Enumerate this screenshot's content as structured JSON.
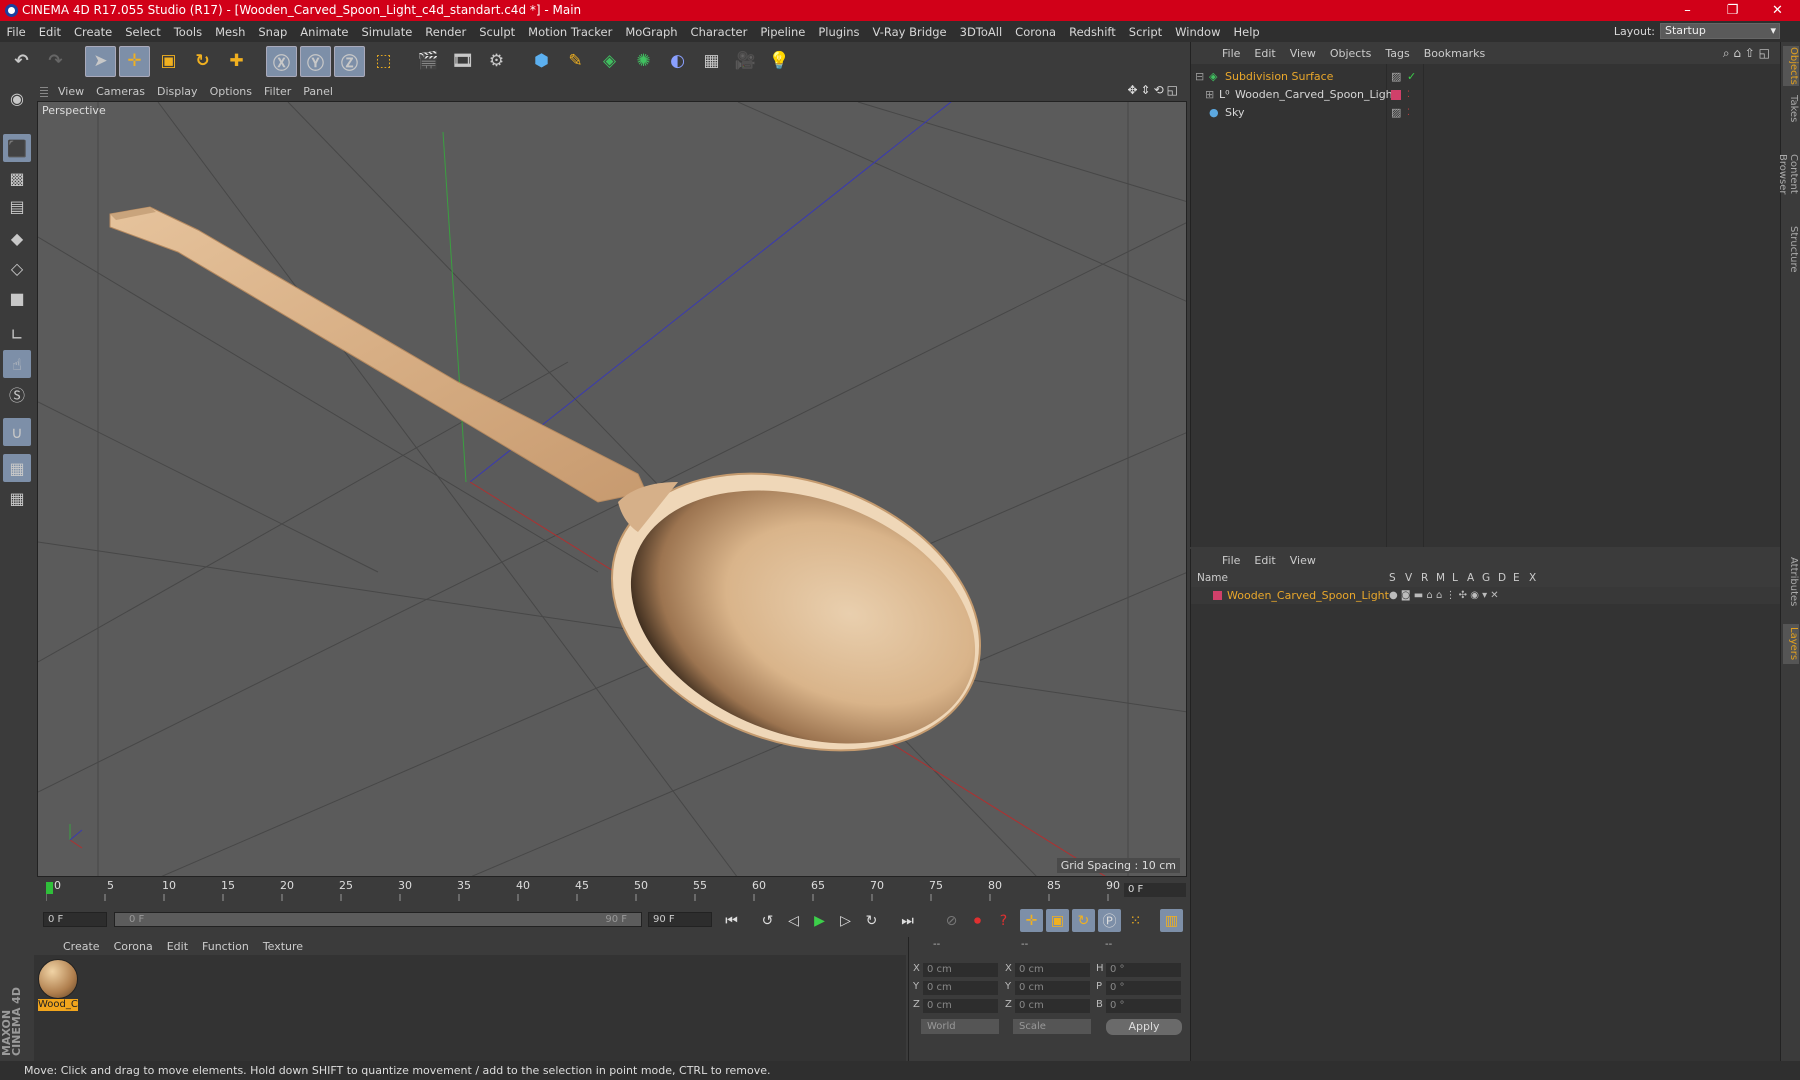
{
  "window": {
    "title": "CINEMA 4D R17.055 Studio (R17) - [Wooden_Carved_Spoon_Light_c4d_standart.c4d *] - Main",
    "controls": [
      "–",
      "❐",
      "✕"
    ]
  },
  "menubar": [
    "File",
    "Edit",
    "Create",
    "Select",
    "Tools",
    "Mesh",
    "Snap",
    "Animate",
    "Simulate",
    "Render",
    "Sculpt",
    "Motion Tracker",
    "MoGraph",
    "Character",
    "Pipeline",
    "Plugins",
    "V-Ray Bridge",
    "3DToAll",
    "Corona",
    "Redshift",
    "Script",
    "Window",
    "Help"
  ],
  "layout": {
    "label": "Layout:",
    "value": "Startup"
  },
  "viewport": {
    "menu": [
      "View",
      "Cameras",
      "Display",
      "Options",
      "Filter",
      "Panel"
    ],
    "camera_label": "Perspective",
    "grid_spacing": "Grid Spacing : 10 cm"
  },
  "timeline": {
    "ticks": [
      "0",
      "5",
      "10",
      "15",
      "20",
      "25",
      "30",
      "35",
      "40",
      "45",
      "50",
      "55",
      "60",
      "65",
      "70",
      "75",
      "80",
      "85",
      "90"
    ],
    "current_frame": "0 F"
  },
  "transport": {
    "start": "0 F",
    "slider_left": "0 F",
    "slider_right": "90 F",
    "end": "90 F"
  },
  "materials": {
    "menu": [
      "Create",
      "Corona",
      "Edit",
      "Function",
      "Texture"
    ],
    "items": [
      {
        "label": "Wood_C"
      }
    ]
  },
  "coordinates": {
    "headers": [
      "--",
      "--",
      "--"
    ],
    "rows": [
      {
        "a": "X",
        "av": "0 cm",
        "b": "X",
        "bv": "0 cm",
        "c": "H",
        "cv": "0 °"
      },
      {
        "a": "Y",
        "av": "0 cm",
        "b": "Y",
        "bv": "0 cm",
        "c": "P",
        "cv": "0 °"
      },
      {
        "a": "Z",
        "av": "0 cm",
        "b": "Z",
        "bv": "0 cm",
        "c": "B",
        "cv": "0 °"
      }
    ],
    "mode": "World",
    "scale": "Scale",
    "apply": "Apply"
  },
  "objects": {
    "menu": [
      "File",
      "Edit",
      "View",
      "Objects",
      "Tags",
      "Bookmarks"
    ],
    "items": [
      {
        "name": "Subdivision Surface",
        "color": "#e9a72b"
      },
      {
        "name": "Wooden_Carved_Spoon_Light",
        "color": "#d6d6d6"
      },
      {
        "name": "Sky",
        "color": "#d6d6d6"
      }
    ]
  },
  "layers": {
    "menu": [
      "File",
      "Edit",
      "View"
    ],
    "header": {
      "name": "Name",
      "cols": [
        "S",
        "V",
        "R",
        "M",
        "L",
        "A",
        "G",
        "D",
        "E",
        "X"
      ]
    },
    "rows": [
      {
        "name": "Wooden_Carved_Spoon_Light",
        "color": "#e9a72b"
      }
    ]
  },
  "side_tabs": [
    "Objects",
    "Takes",
    "Content Browser",
    "Structure",
    "Attributes",
    "Layers"
  ],
  "brand": "MAXON CINEMA 4D",
  "status": "Move: Click and drag to move elements. Hold down SHIFT to quantize movement / add to the selection in point mode, CTRL to remove."
}
